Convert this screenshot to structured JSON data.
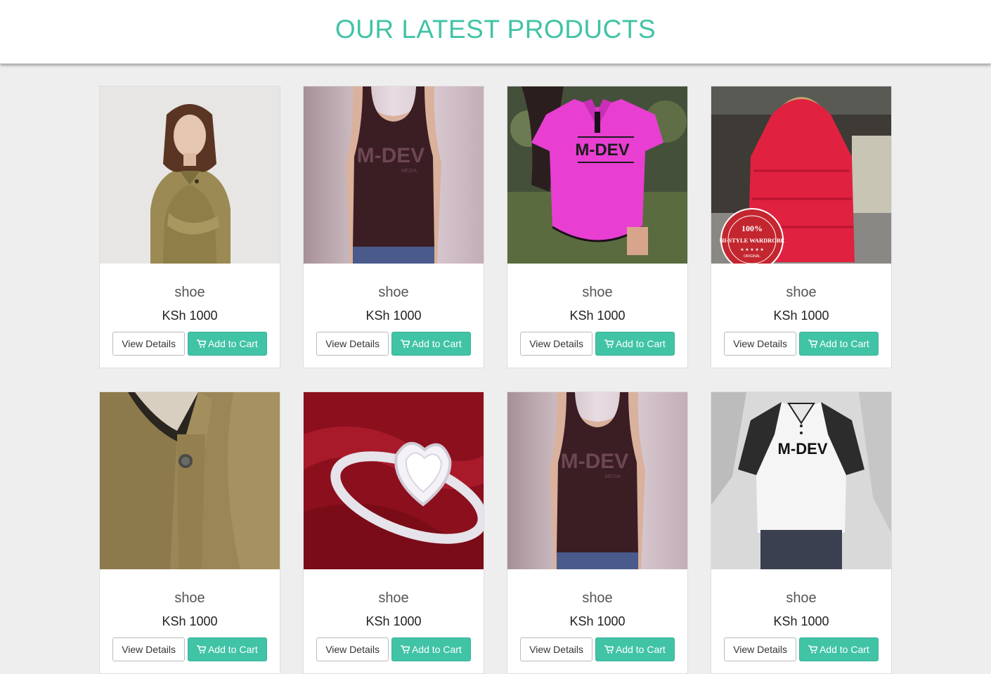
{
  "header": {
    "title": "OUR LATEST PRODUCTS"
  },
  "buttons": {
    "view_details": "View Details",
    "add_to_cart": "Add to Cart"
  },
  "accent_color": "#41c3a6",
  "products": [
    {
      "name": "shoe",
      "price": "KSh 1000",
      "image": "olive-jacket-woman"
    },
    {
      "name": "shoe",
      "price": "KSh 1000",
      "image": "tank-top-mdev"
    },
    {
      "name": "shoe",
      "price": "KSh 1000",
      "image": "pink-polo-mdev"
    },
    {
      "name": "shoe",
      "price": "KSh 1000",
      "image": "red-puffer-jacket"
    },
    {
      "name": "shoe",
      "price": "KSh 1000",
      "image": "olive-jacket-collar"
    },
    {
      "name": "shoe",
      "price": "KSh 1000",
      "image": "diamond-heart-ring"
    },
    {
      "name": "shoe",
      "price": "KSh 1000",
      "image": "tank-top-mdev"
    },
    {
      "name": "shoe",
      "price": "KSh 1000",
      "image": "white-polo-mdev"
    }
  ],
  "image_text": {
    "mdev": "M-DEV",
    "media": "MEDIA",
    "badge_pct": "100%",
    "badge_label": "HI-STYLE WARDROBE",
    "badge_stars": "★ ★ ★ ★ ★",
    "badge_original": "ORIGINAL"
  },
  "icons": {
    "cart": "shopping-cart-icon"
  }
}
